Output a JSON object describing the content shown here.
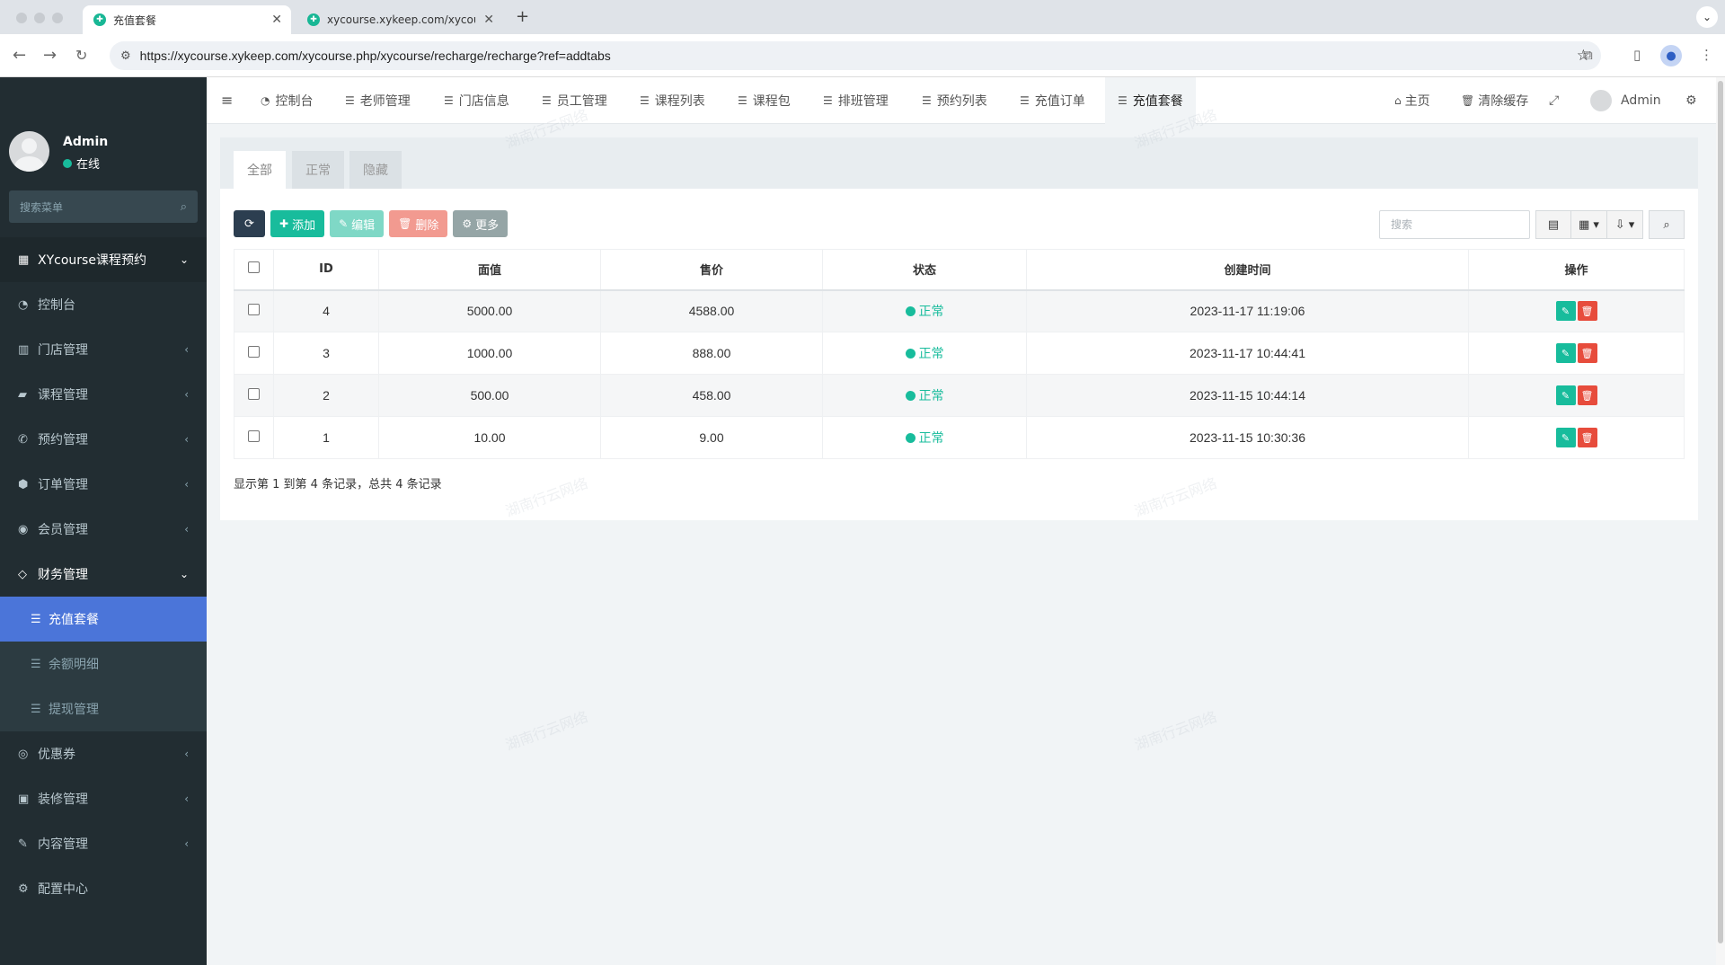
{
  "browser": {
    "tabs": [
      {
        "title": "充值套餐",
        "active": true
      },
      {
        "title": "xycourse.xykeep.com/xycour",
        "active": false
      }
    ],
    "url": "https://xycourse.xykeep.com/xycourse.php/xycourse/recharge/recharge?ref=addtabs"
  },
  "sidebar": {
    "user": {
      "name": "Admin",
      "status": "在线"
    },
    "search_placeholder": "搜索菜单",
    "menu": [
      {
        "label": "XYcourse课程预约",
        "icon": "grid-icon",
        "state": "open"
      },
      {
        "label": "控制台",
        "icon": "dashboard-icon"
      },
      {
        "label": "门店管理",
        "icon": "store-icon",
        "arrow": "‹"
      },
      {
        "label": "课程管理",
        "icon": "book-icon",
        "arrow": "‹"
      },
      {
        "label": "预约管理",
        "icon": "whatsapp-icon",
        "arrow": "‹"
      },
      {
        "label": "订单管理",
        "icon": "cube-icon",
        "arrow": "‹"
      },
      {
        "label": "会员管理",
        "icon": "user-circle-icon",
        "arrow": "‹"
      },
      {
        "label": "财务管理",
        "icon": "diamond-icon",
        "state": "open"
      },
      {
        "label": "充值套餐",
        "icon": "list-icon",
        "sub": true,
        "active": true
      },
      {
        "label": "余额明细",
        "icon": "list-icon",
        "sub": true
      },
      {
        "label": "提现管理",
        "icon": "list-icon",
        "sub": true
      },
      {
        "label": "优惠券",
        "icon": "coupon-icon",
        "arrow": "‹"
      },
      {
        "label": "装修管理",
        "icon": "image-icon",
        "arrow": "‹"
      },
      {
        "label": "内容管理",
        "icon": "edit-icon",
        "arrow": "‹"
      },
      {
        "label": "配置中心",
        "icon": "gear-icon"
      }
    ]
  },
  "topnav": {
    "tabs": [
      "控制台",
      "老师管理",
      "门店信息",
      "员工管理",
      "课程列表",
      "课程包",
      "排班管理",
      "预约列表",
      "充值订单",
      "充值套餐"
    ],
    "active_tab": "充值套餐",
    "home": "主页",
    "clear_cache": "清除缓存",
    "admin": "Admin"
  },
  "panel": {
    "tabs": [
      "全部",
      "正常",
      "隐藏"
    ],
    "toolbar": {
      "add": "添加",
      "edit": "编辑",
      "delete": "删除",
      "more": "更多"
    },
    "search_placeholder": "搜索",
    "columns": [
      "ID",
      "面值",
      "售价",
      "状态",
      "创建时间",
      "操作"
    ],
    "rows": [
      {
        "id": "4",
        "face": "5000.00",
        "price": "4588.00",
        "status": "正常",
        "created": "2023-11-17 11:19:06"
      },
      {
        "id": "3",
        "face": "1000.00",
        "price": "888.00",
        "status": "正常",
        "created": "2023-11-17 10:44:41"
      },
      {
        "id": "2",
        "face": "500.00",
        "price": "458.00",
        "status": "正常",
        "created": "2023-11-15 10:44:14"
      },
      {
        "id": "1",
        "face": "10.00",
        "price": "9.00",
        "status": "正常",
        "created": "2023-11-15 10:30:36"
      }
    ],
    "page_info": "显示第 1 到第 4 条记录，总共 4 条记录"
  },
  "watermark": "湖南行云网络",
  "colors": {
    "accent": "#18bc9c",
    "sidebar_bg": "#222d32",
    "active_menu": "#4b75d9",
    "danger": "#e74c3c"
  }
}
